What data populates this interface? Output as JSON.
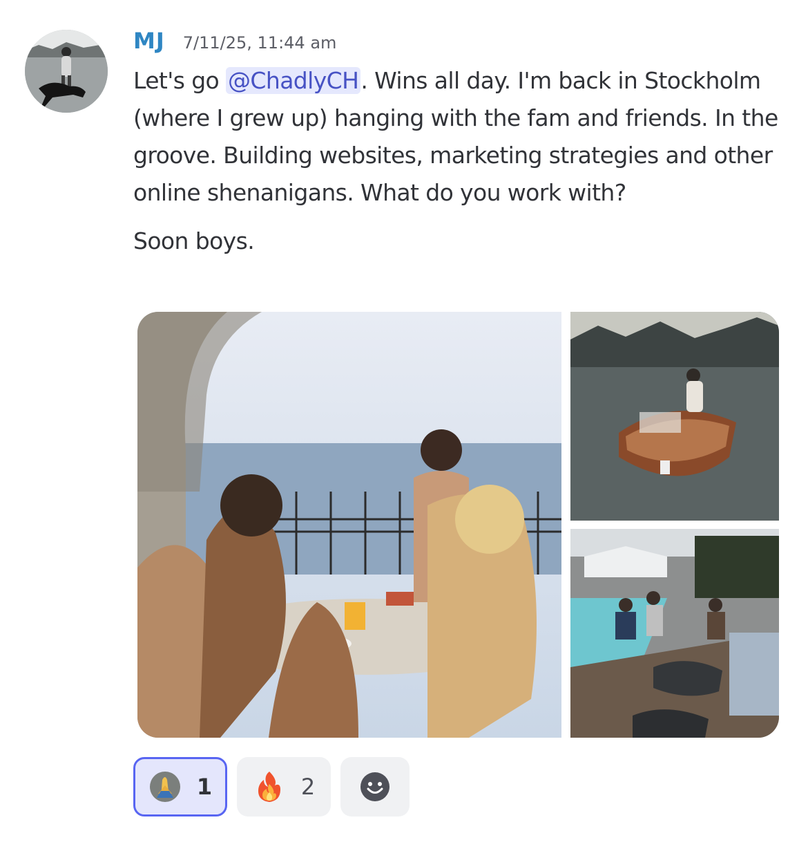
{
  "message": {
    "author": "MJ",
    "timestamp": "7/11/25, 11:44 am",
    "paragraph1": {
      "before_mention": "Let's go ",
      "mention": "@ChadlyCH",
      "after_mention": ". Wins all day. I'm back in Stockholm (where I grew up) hanging with the fam and friends. In the groove. Building websites, marketing strategies and other online shenanigans. What do you work with?"
    },
    "paragraph2": "Soon boys."
  },
  "reactions": [
    {
      "emoji": "praying-hands-icon",
      "count": "1",
      "selected": true
    },
    {
      "emoji": "fire-icon",
      "count": "2",
      "selected": false
    }
  ],
  "colors": {
    "author": "#2f86c3",
    "mention_bg": "#e5e8fd",
    "mention_text": "#4752c4",
    "selected_reaction_border": "#5865f2",
    "selected_reaction_bg": "#e4e6fc"
  }
}
